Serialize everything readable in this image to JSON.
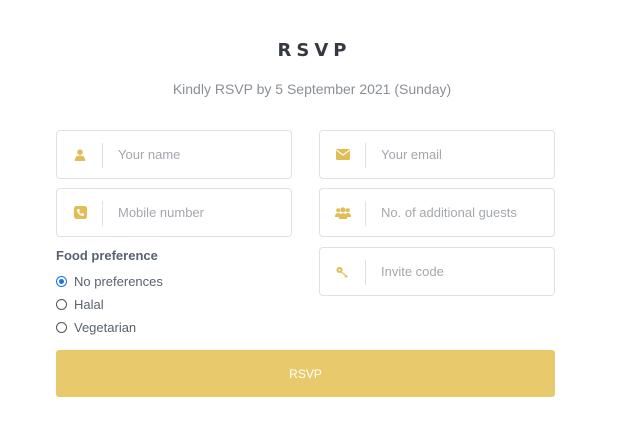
{
  "header": {
    "title": "RSVP",
    "subtitle": "Kindly RSVP by 5 September 2021 (Sunday)"
  },
  "form": {
    "name": {
      "placeholder": "Your name",
      "icon": "user-icon"
    },
    "email": {
      "placeholder": "Your email",
      "icon": "envelope-icon"
    },
    "mobile": {
      "placeholder": "Mobile number",
      "icon": "phone-icon"
    },
    "guests": {
      "placeholder": "No. of additional guests",
      "icon": "users-icon"
    },
    "invite": {
      "placeholder": "Invite code",
      "icon": "key-icon"
    },
    "food": {
      "label": "Food preference",
      "options": [
        {
          "label": "No preferences",
          "checked": true
        },
        {
          "label": "Halal",
          "checked": false
        },
        {
          "label": "Vegetarian",
          "checked": false
        }
      ]
    },
    "submit_label": "RSVP"
  },
  "colors": {
    "accent": "#e8ca6d",
    "icon": "#e0bd55",
    "radio_selected": "#1a73e8"
  }
}
